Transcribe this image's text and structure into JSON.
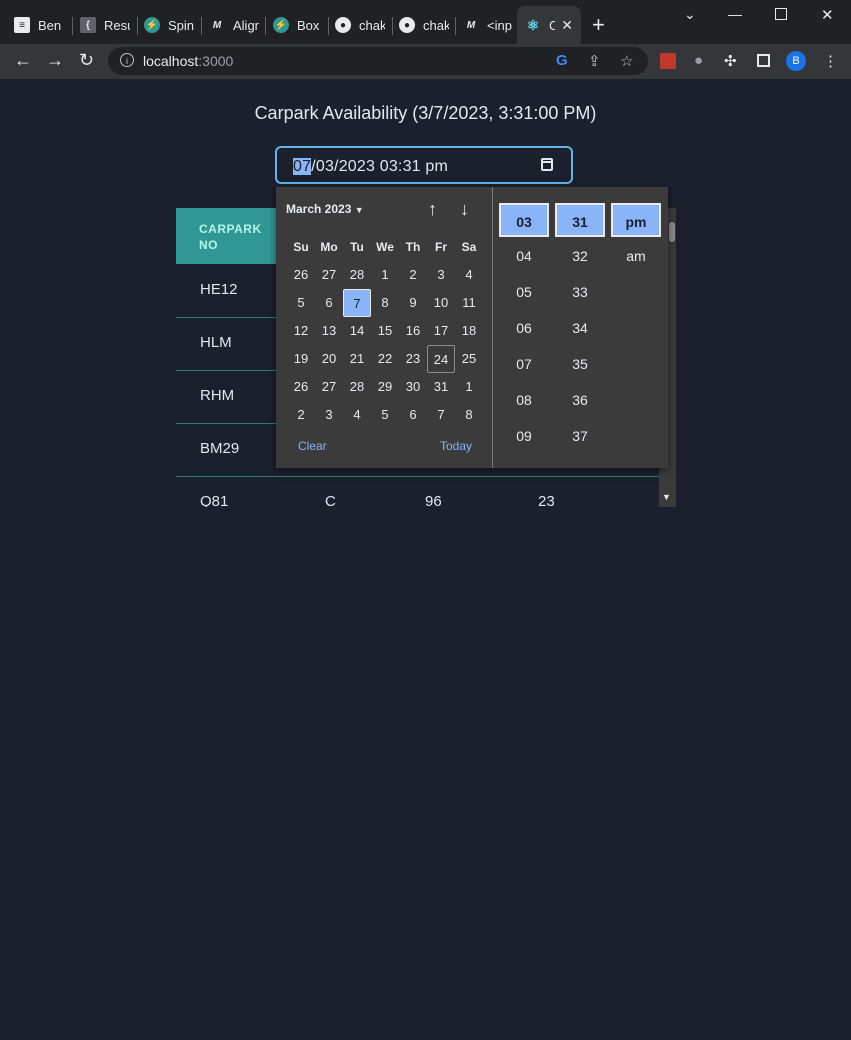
{
  "browser": {
    "tabs": [
      {
        "label": "Ben",
        "icon": "doc-icon"
      },
      {
        "label": "Resu",
        "icon": "json-icon"
      },
      {
        "label": "Spin",
        "icon": "bolt-icon"
      },
      {
        "label": "Align",
        "icon": "m-icon"
      },
      {
        "label": "Box",
        "icon": "bolt-icon"
      },
      {
        "label": "chak",
        "icon": "github-icon"
      },
      {
        "label": "chak",
        "icon": "github-icon"
      },
      {
        "label": "<inp",
        "icon": "m-icon"
      },
      {
        "label": "C",
        "icon": "react-icon"
      }
    ],
    "url_host": "localhost",
    "url_port": ":3000",
    "profile_initial": "B"
  },
  "page": {
    "title": "Carpark Availability (3/7/2023, 3:31:00 PM)"
  },
  "datetime_input": {
    "selected_segment": "07",
    "rest_value": "/03/2023 03:31 pm"
  },
  "table": {
    "header": {
      "col1": "CARPARK NO"
    },
    "rows": [
      {
        "c1": "HE12"
      },
      {
        "c1": "HLM"
      },
      {
        "c1": "RHM"
      },
      {
        "c1": "BM29"
      },
      {
        "c1": "Q81",
        "c2": "C",
        "c3": "96",
        "c4": "23"
      }
    ]
  },
  "picker": {
    "month_label": "March 2023",
    "weekdays": [
      "Su",
      "Mo",
      "Tu",
      "We",
      "Th",
      "Fr",
      "Sa"
    ],
    "days": [
      "26",
      "27",
      "28",
      "1",
      "2",
      "3",
      "4",
      "5",
      "6",
      "7",
      "8",
      "9",
      "10",
      "11",
      "12",
      "13",
      "14",
      "15",
      "16",
      "17",
      "18",
      "19",
      "20",
      "21",
      "22",
      "23",
      "24",
      "25",
      "26",
      "27",
      "28",
      "29",
      "30",
      "31",
      "1",
      "2",
      "3",
      "4",
      "5",
      "6",
      "7",
      "8"
    ],
    "selected_day_index": 9,
    "today_day_index": 26,
    "clear_label": "Clear",
    "today_label": "Today",
    "hours": [
      "03",
      "04",
      "05",
      "06",
      "07",
      "08",
      "09"
    ],
    "minutes": [
      "31",
      "32",
      "33",
      "34",
      "35",
      "36",
      "37"
    ],
    "meridiem": [
      "pm",
      "am"
    ],
    "accent_color": "#8ab4f8"
  }
}
